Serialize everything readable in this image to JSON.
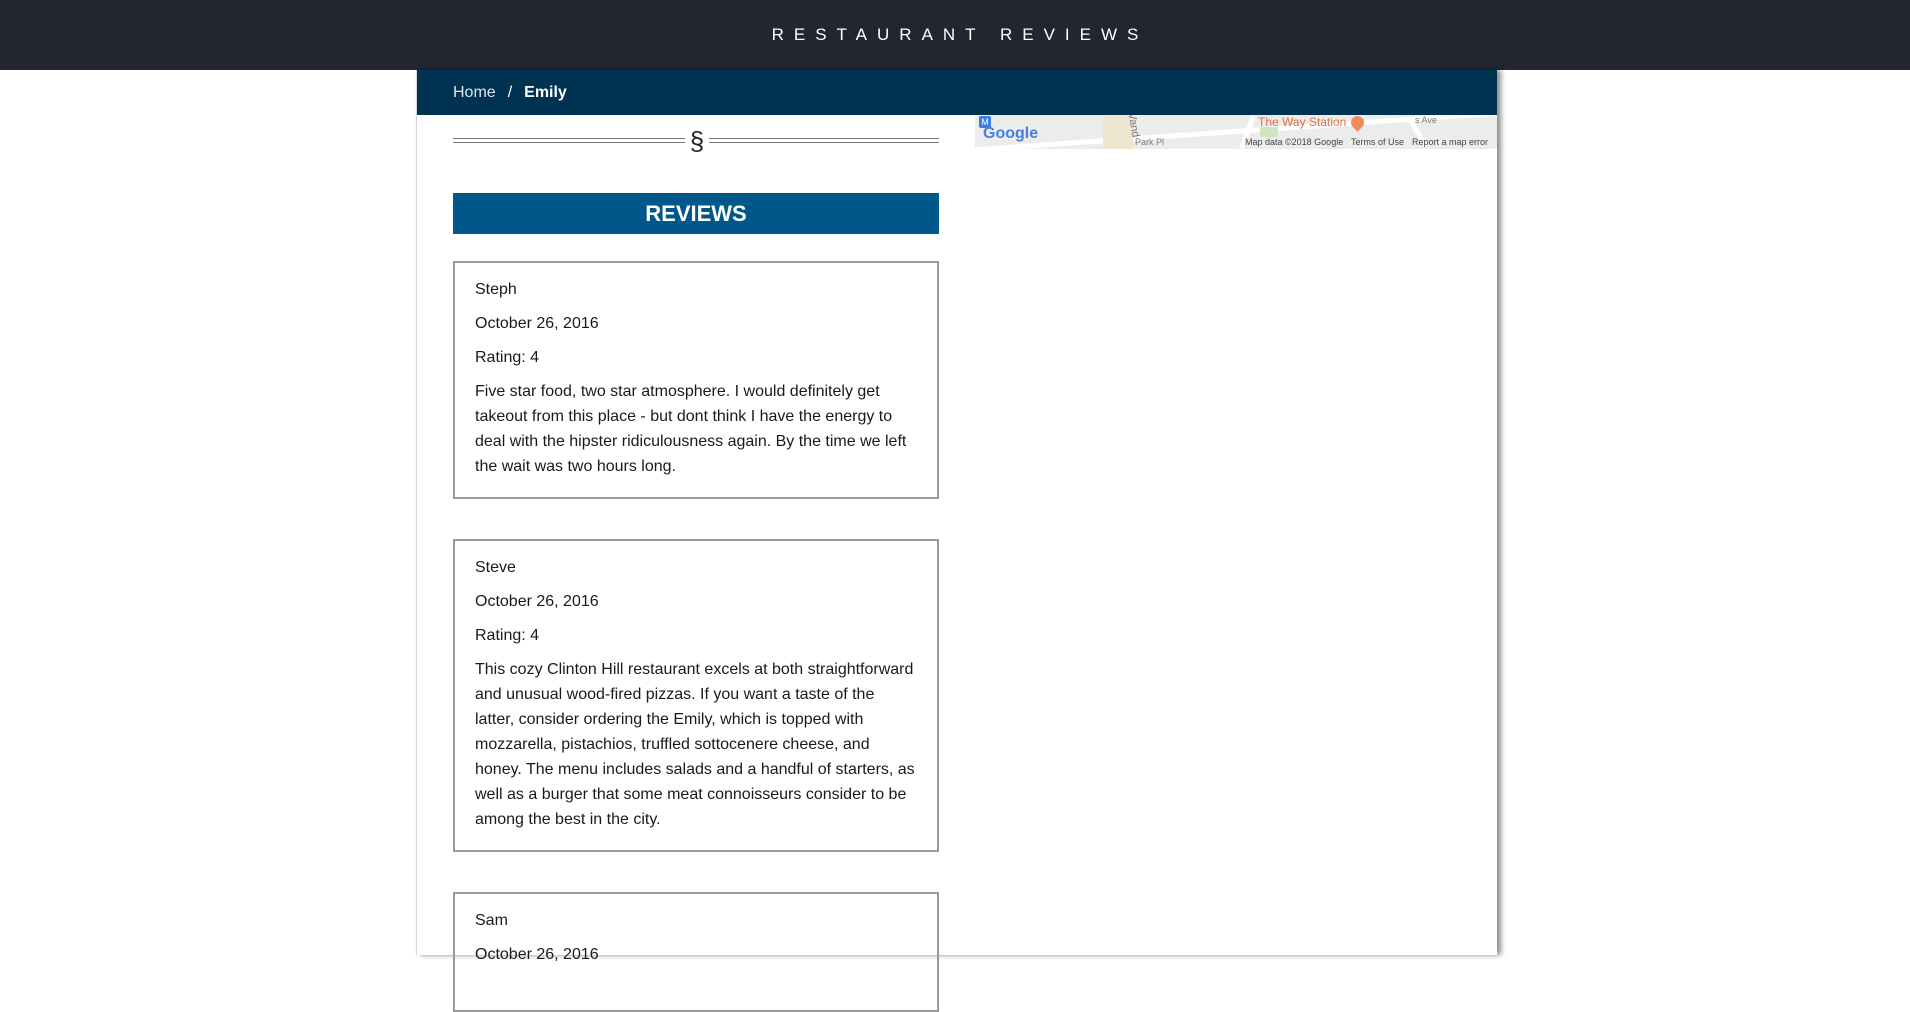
{
  "header": {
    "title": "RESTAURANT REVIEWS"
  },
  "breadcrumb": {
    "home": "Home",
    "separator": "/",
    "current": "Emily"
  },
  "map": {
    "poi_label": "The Way Station",
    "street_labels": [
      "Vand",
      "Park Pl",
      "s Ave"
    ],
    "logo": "Google",
    "metro_badge": "M",
    "attribution": "Map data ©2018 Google",
    "terms": "Terms of Use",
    "report": "Report a map error"
  },
  "divider": {
    "symbol": "§"
  },
  "reviews": {
    "heading": "REVIEWS",
    "items": [
      {
        "name": "Steph",
        "date": "October 26, 2016",
        "rating": "Rating: 4",
        "comments": "Five star food, two star atmosphere. I would definitely get takeout from this place - but dont think I have the energy to deal with the hipster ridiculousness again. By the time we left the wait was two hours long."
      },
      {
        "name": "Steve",
        "date": "October 26, 2016",
        "rating": "Rating: 4",
        "comments": "This cozy Clinton Hill restaurant excels at both straightforward and unusual wood-fired pizzas. If you want a taste of the latter, consider ordering the Emily, which is topped with mozzarella, pistachios, truffled sottocenere cheese, and honey. The menu includes salads and a handful of starters, as well as a burger that some meat connoisseurs consider to be among the best in the city."
      },
      {
        "name": "Sam",
        "date": "October 26, 2016",
        "rating": "",
        "comments": ""
      }
    ]
  }
}
